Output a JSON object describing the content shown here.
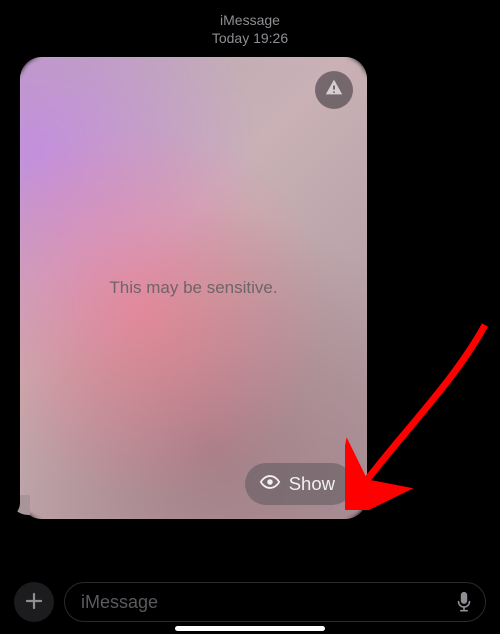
{
  "header": {
    "service": "iMessage",
    "timestamp": "Today 19:26"
  },
  "message": {
    "sensitive_label": "This may be sensitive.",
    "show_label": "Show"
  },
  "compose": {
    "placeholder": "iMessage"
  }
}
